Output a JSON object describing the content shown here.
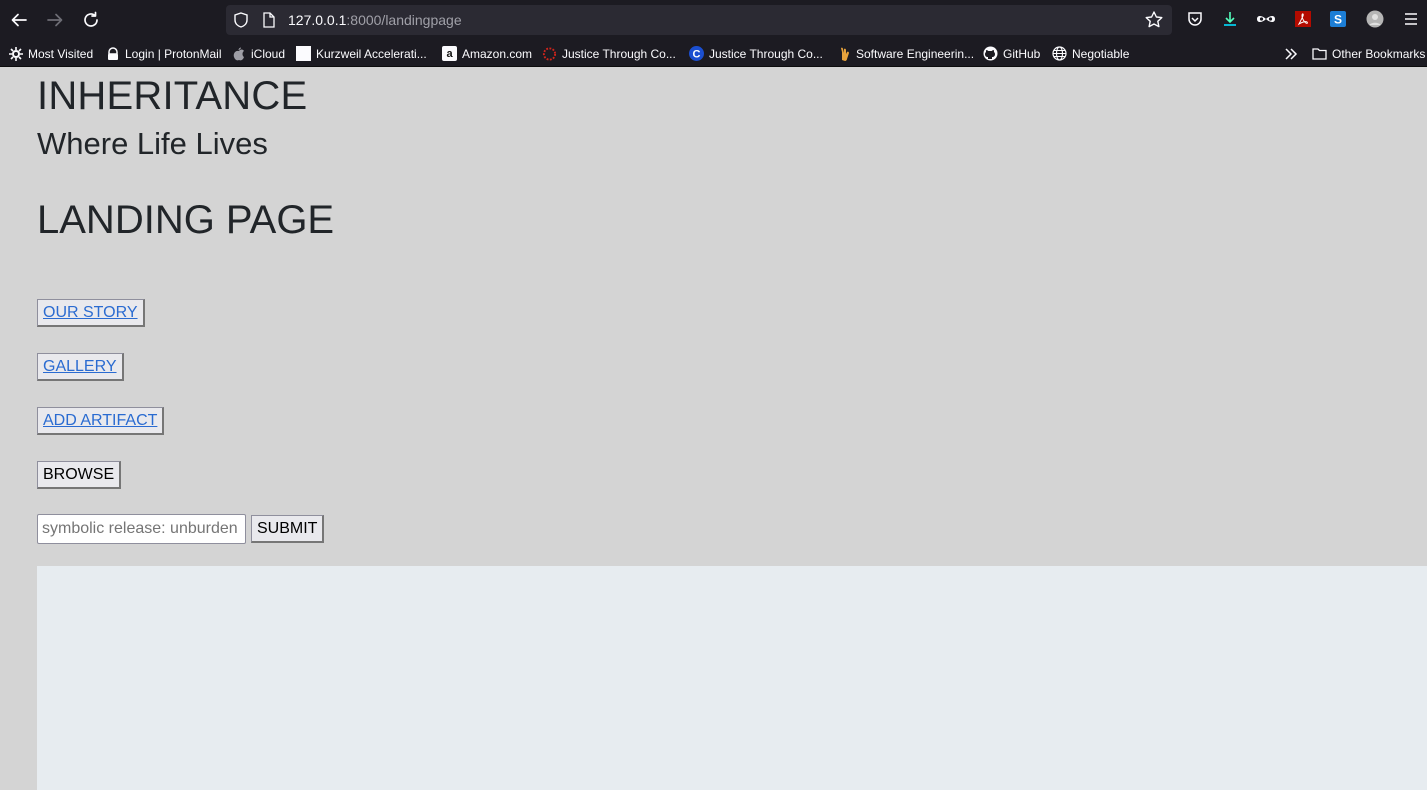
{
  "browser": {
    "url_host": "127.0.0.1",
    "url_rest": ":8000/landingpage",
    "bookmarks": [
      {
        "label": "Most Visited",
        "icon": "gear-icon"
      },
      {
        "label": "Login | ProtonMail",
        "icon": "protonmail-icon"
      },
      {
        "label": "iCloud",
        "icon": "apple-icon"
      },
      {
        "label": "Kurzweil Accelerati...",
        "icon": "page-icon"
      },
      {
        "label": "Amazon.com",
        "icon": "amazon-icon"
      },
      {
        "label": "Justice Through Co...",
        "icon": "ring-icon"
      },
      {
        "label": "Justice Through Co...",
        "icon": "c-icon"
      },
      {
        "label": "Software Engineerin...",
        "icon": "hand-icon"
      },
      {
        "label": "GitHub",
        "icon": "github-icon"
      },
      {
        "label": "Negotiable",
        "icon": "globe-icon"
      }
    ],
    "other_bookmarks": "Other Bookmarks"
  },
  "page": {
    "title": "INHERITANCE",
    "subtitle": "Where Life Lives",
    "heading": "LANDING PAGE",
    "links": {
      "our_story": "OUR STORY",
      "gallery": "GALLERY",
      "add_artifact": "ADD ARTIFACT"
    },
    "browse_label": "BROWSE",
    "input_placeholder": "symbolic release: unburden",
    "submit_label": "SUBMIT"
  },
  "colors": {
    "page_bg": "#d4d4d4",
    "panel_bg": "#e7ecf0",
    "link": "#2a6bd1"
  }
}
